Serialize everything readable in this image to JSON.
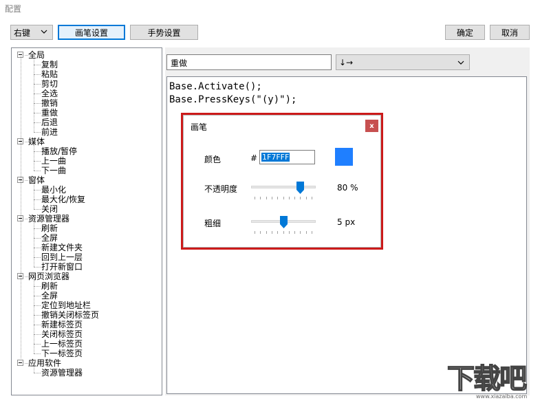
{
  "window": {
    "title": "配置"
  },
  "toolbar": {
    "mouse_select": "右键",
    "pen_settings": "画笔设置",
    "gesture_settings": "手势设置",
    "ok": "确定",
    "cancel": "取消"
  },
  "tree": {
    "groups": [
      {
        "label": "全局",
        "items": [
          "复制",
          "粘贴",
          "剪切",
          "全选",
          "撤销",
          "重做",
          "后退",
          "前进"
        ]
      },
      {
        "label": "媒体",
        "items": [
          "播放/暂停",
          "上一曲",
          "下一曲"
        ]
      },
      {
        "label": "窗体",
        "items": [
          "最小化",
          "最大化/恢复",
          "关闭"
        ]
      },
      {
        "label": "资源管理器",
        "items": [
          "刷新",
          "全屏",
          "新建文件夹",
          "回到上一层",
          "打开新窗口"
        ]
      },
      {
        "label": "网页浏览器",
        "items": [
          "刷新",
          "全屏",
          "定位到地址栏",
          "撤销关闭标签页",
          "新建标签页",
          "关闭标签页",
          "上一标签页",
          "下一标签页"
        ]
      },
      {
        "label": "应用软件",
        "items": [
          "资源管理器"
        ]
      }
    ]
  },
  "editor": {
    "name_value": "重做",
    "gesture_value": "↓→",
    "code_lines": [
      "Base.Activate();",
      "Base.PressKeys(\"(y)\");"
    ]
  },
  "pen_dialog": {
    "title": "画笔",
    "close": "x",
    "color_label": "颜色",
    "hash": "#",
    "color_hex": "1F7FFF",
    "color_value": "#1F7FFF",
    "opacity_label": "不透明度",
    "opacity_value": "80 %",
    "opacity_fraction": 0.8,
    "width_label": "粗细",
    "width_value": "5 px",
    "width_fraction": 0.5
  },
  "colors": {
    "accent": "#0078d7",
    "highlight_border": "#cc1a1a",
    "close_button": "#c75050"
  },
  "watermark": {
    "text": "下载吧",
    "url": "www.xiazaiba.com"
  }
}
